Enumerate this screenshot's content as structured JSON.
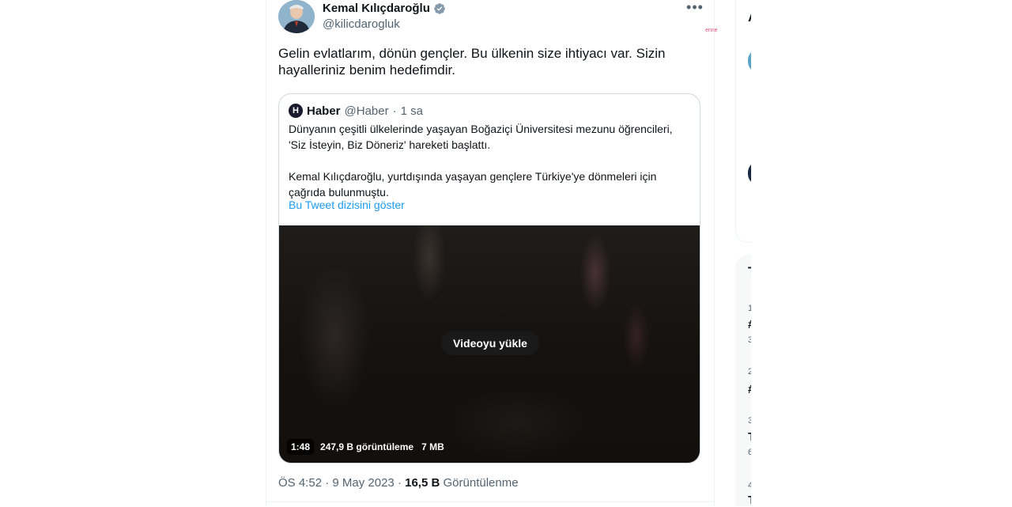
{
  "author": {
    "name": "Kemal Kılıçdaroğlu",
    "handle": "@kilicdarogluk"
  },
  "watermark": "erine",
  "tweet": {
    "text": "Gelin evlatlarım, dönün gençler. Bu ülkenin size ihtiyacı var. Sizin hayalleriniz benim hedefimdir."
  },
  "quote": {
    "logo_letter": "H",
    "name": "Haber",
    "handle": "@Haber",
    "dot": "·",
    "time": "1 sa",
    "text": "Dünyanın çeşitli ülkelerinde yaşayan Boğaziçi Üniversitesi mezunu öğrencileri,\n'Siz İsteyin, Biz Döneriz' hareketi başlattı.\n\nKemal Kılıçdaroğlu, yurtdışında yaşayan gençlere Türkiye'ye dönmeleri için\nçağrıda bulunmuştu.",
    "thread_link": "Bu Tweet dizisini göster",
    "video": {
      "load_label": "Videoyu yükle",
      "duration": "1:48",
      "views": "247,9 B görüntüleme",
      "size": "7 MB"
    }
  },
  "footer": {
    "time": "ÖS 4:52",
    "dot": "·",
    "date": "9 May 2023",
    "dot2": "·",
    "views_count": "16,5 B",
    "views_label": "Görüntülenme"
  },
  "sidebar_fragments": {
    "a": "A",
    "t": "T",
    "n1": "1",
    "hash1": "#",
    "n2": "3",
    "n3": "2",
    "hash2": "#",
    "n4": "3",
    "t2": "T",
    "n5": "6",
    "n6": "4",
    "t3": "T"
  },
  "icons": {
    "verified": "verified-badge-icon",
    "more": "more-options-icon"
  },
  "colors": {
    "accent": "#1d9bf0",
    "muted": "#536471",
    "text": "#0f1419"
  }
}
